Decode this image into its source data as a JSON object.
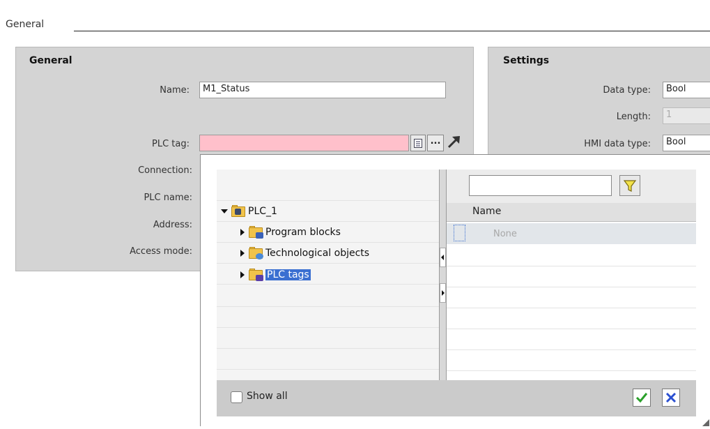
{
  "section": {
    "title": "General"
  },
  "general_panel": {
    "title": "General",
    "fields": {
      "name_label": "Name:",
      "name_value": "M1_Status",
      "plc_tag_label": "PLC tag:",
      "plc_tag_value": "",
      "connection_label": "Connection:",
      "plc_name_label": "PLC name:",
      "address_label": "Address:",
      "access_mode_label": "Access mode:"
    },
    "browse_button": "...",
    "colors": {
      "plc_tag_invalid": "#ffc0cb"
    }
  },
  "settings_panel": {
    "title": "Settings",
    "fields": {
      "data_type_label": "Data type:",
      "data_type_value": "Bool",
      "length_label": "Length:",
      "length_value": "1",
      "hmi_data_type_label": "HMI data type:",
      "hmi_data_type_value": "Bool"
    }
  },
  "tag_picker": {
    "tree": {
      "root": {
        "label": "PLC_1",
        "icon": "plc-folder-icon",
        "expanded": true
      },
      "items": [
        {
          "label": "Program blocks",
          "icon": "program-blocks-folder-icon"
        },
        {
          "label": "Technological objects",
          "icon": "technological-objects-folder-icon"
        },
        {
          "label": "PLC tags",
          "icon": "plc-tags-folder-icon",
          "selected": true
        }
      ]
    },
    "filter": {
      "value": "",
      "icon": "filter-icon"
    },
    "list": {
      "column_name": "Name",
      "rows": [
        {
          "name": "None"
        }
      ]
    },
    "footer": {
      "show_all_label": "Show all",
      "show_all_checked": false,
      "ok_icon": "checkmark-icon",
      "cancel_icon": "close-icon"
    },
    "colors": {
      "selection": "#3a6fd1",
      "ok": "#2aa02a",
      "cancel": "#2a4fd1"
    }
  }
}
